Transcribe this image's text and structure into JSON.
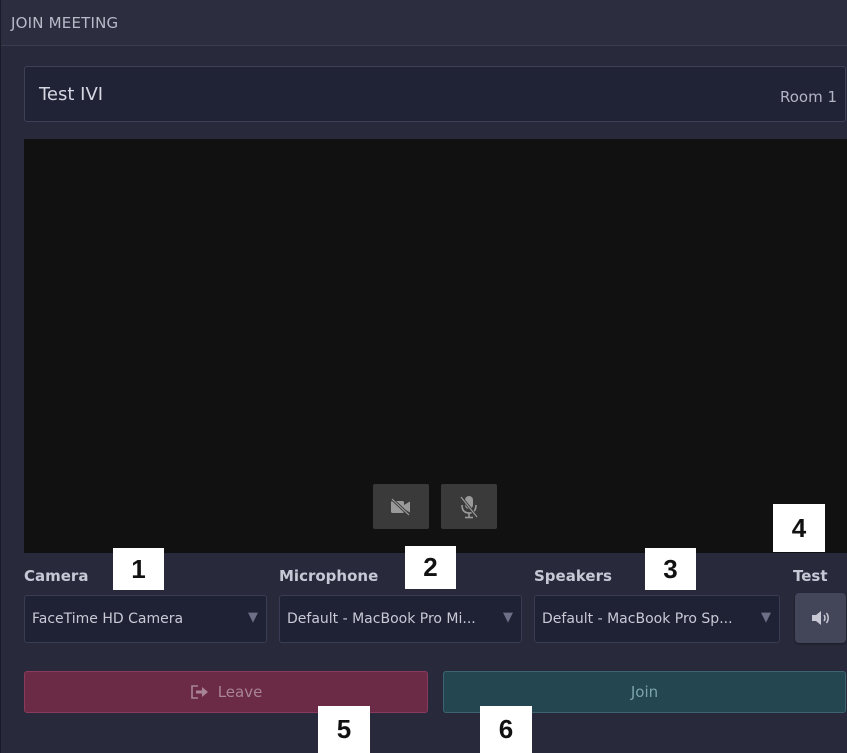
{
  "header": {
    "title": "JOIN MEETING"
  },
  "room": {
    "name": "Test IVI",
    "label": "Room 1"
  },
  "preview": {
    "camera_toggle_icon": "camera-off-icon",
    "mic_toggle_icon": "mic-off-icon"
  },
  "devices": {
    "camera": {
      "label": "Camera",
      "value": "FaceTime HD Camera"
    },
    "microphone": {
      "label": "Microphone",
      "value": "Default - MacBook Pro Mi..."
    },
    "speakers": {
      "label": "Speakers",
      "value": "Default - MacBook Pro Sp..."
    },
    "test": {
      "label": "Test",
      "icon": "speaker-icon"
    }
  },
  "actions": {
    "leave": "Leave",
    "join": "Join",
    "leave_icon": "exit-icon"
  },
  "callouts": [
    "1",
    "2",
    "3",
    "4",
    "5",
    "6"
  ],
  "colors": {
    "leave_bg": "#6b2a46",
    "join_bg": "#234650",
    "panel_bg": "#282a3c"
  }
}
